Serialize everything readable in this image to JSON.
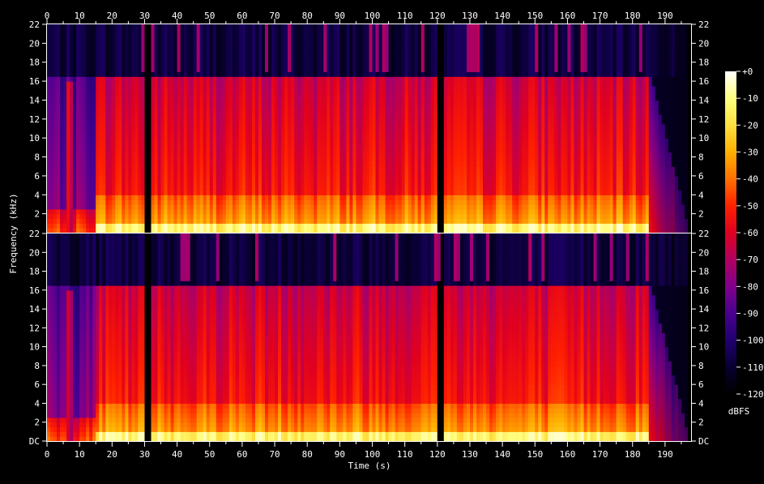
{
  "chart_data": {
    "type": "heatmap",
    "xlabel": "Time (s)",
    "ylabel": "Frequency (kHz)",
    "x_ticks": [
      "0",
      "10",
      "20",
      "30",
      "40",
      "50",
      "60",
      "70",
      "80",
      "90",
      "100",
      "110",
      "120",
      "130",
      "140",
      "150",
      "160",
      "170",
      "180",
      "190"
    ],
    "x_minor_ticks": [
      "5",
      "15",
      "25",
      "35",
      "45",
      "55",
      "65",
      "75",
      "85",
      "95",
      "105",
      "115",
      "125",
      "135",
      "145",
      "155",
      "165",
      "175",
      "185",
      "195"
    ],
    "xlim": [
      0,
      198
    ],
    "y_ticks_channel_1": [
      "22",
      "20",
      "18",
      "16",
      "14",
      "12",
      "10",
      "8",
      "6",
      "4",
      "2"
    ],
    "y_ticks_channel_2": [
      "22",
      "20",
      "18",
      "16",
      "14",
      "12",
      "10",
      "8",
      "6",
      "4",
      "2",
      "DC"
    ],
    "ylim_khz": [
      0,
      22
    ],
    "colorbar": {
      "label": "dBFS",
      "ticks": [
        "+0",
        "-10",
        "-20",
        "-30",
        "-40",
        "-50",
        "-60",
        "-70",
        "-80",
        "-90",
        "-100",
        "-110",
        "-120"
      ],
      "range_db": [
        -120,
        0
      ],
      "colors": [
        "#ffffff",
        "#ffff80",
        "#ffe040",
        "#ffb000",
        "#ff7000",
        "#ff2000",
        "#e00020",
        "#b00060",
        "#80008c",
        "#4a0090",
        "#200070",
        "#080030",
        "#000000"
      ]
    },
    "channels": 2,
    "spectral_features": {
      "lowpass_cutoff_khz": 16.5,
      "rolloff_start_s": 185,
      "end_s": 197,
      "quiet_intro_end_s": 15.5,
      "dropouts_s": [
        31,
        121
      ]
    }
  }
}
